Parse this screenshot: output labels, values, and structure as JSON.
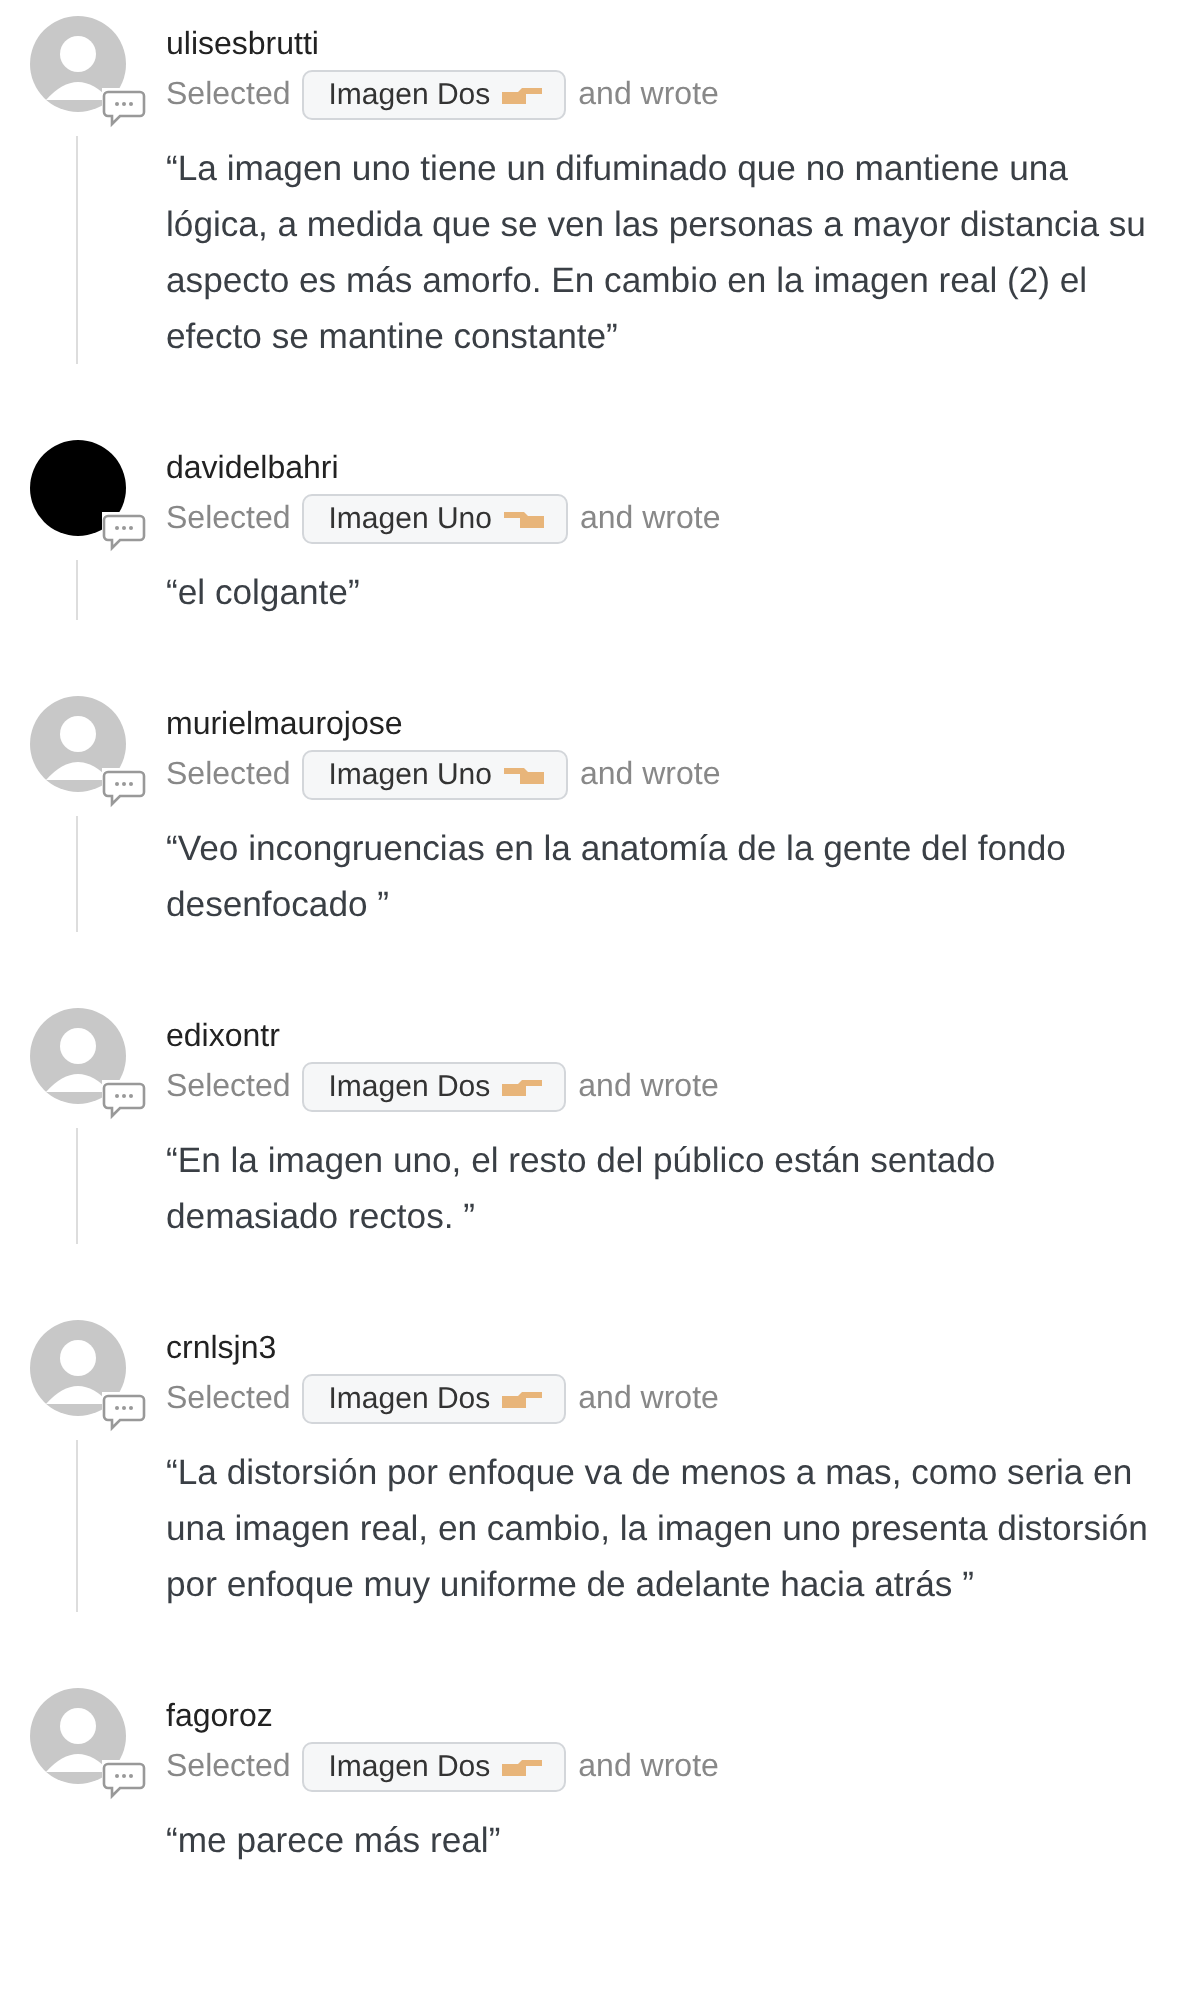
{
  "comments": [
    {
      "username": "ulisesbrutti",
      "avatar": {
        "kind": "placeholder"
      },
      "prefix": "Selected",
      "choice": {
        "label": "Imagen Dos",
        "kind": "point-right"
      },
      "suffix": "and wrote",
      "quote": "“La imagen uno tiene un difuminado que no mantiene una lógica, a medida que se ven las personas a mayor distancia su aspecto es más amorfo. En cambio en la imagen real (2) el efecto se mantine constante”"
    },
    {
      "username": "davidelbahri",
      "avatar": {
        "kind": "dark"
      },
      "prefix": "Selected",
      "choice": {
        "label": "Imagen Uno",
        "kind": "point-left"
      },
      "suffix": "and wrote",
      "quote": "“el colgante”"
    },
    {
      "username": "murielmaurojose",
      "avatar": {
        "kind": "placeholder"
      },
      "prefix": "Selected",
      "choice": {
        "label": "Imagen Uno",
        "kind": "point-left"
      },
      "suffix": "and wrote",
      "quote": "“Veo incongruencias en la anatomía de la gente del fondo desenfocado ”"
    },
    {
      "username": "edixontr",
      "avatar": {
        "kind": "placeholder"
      },
      "prefix": "Selected",
      "choice": {
        "label": "Imagen Dos",
        "kind": "point-right"
      },
      "suffix": "and wrote",
      "quote": "“En la imagen uno, el resto del público están sentado demasiado rectos. ”"
    },
    {
      "username": "crnlsjn3",
      "avatar": {
        "kind": "placeholder"
      },
      "prefix": "Selected",
      "choice": {
        "label": "Imagen Dos",
        "kind": "point-right"
      },
      "suffix": "and wrote",
      "quote": "“La distorsión por enfoque va de menos a mas, como seria en una imagen real, en cambio, la imagen uno presenta distorsión por enfoque muy uniforme de adelante hacia atrás ”"
    },
    {
      "username": "fagoroz",
      "avatar": {
        "kind": "placeholder"
      },
      "prefix": "Selected",
      "choice": {
        "label": "Imagen Dos",
        "kind": "point-right"
      },
      "suffix": "and wrote",
      "quote": "“me parece más real”"
    }
  ]
}
